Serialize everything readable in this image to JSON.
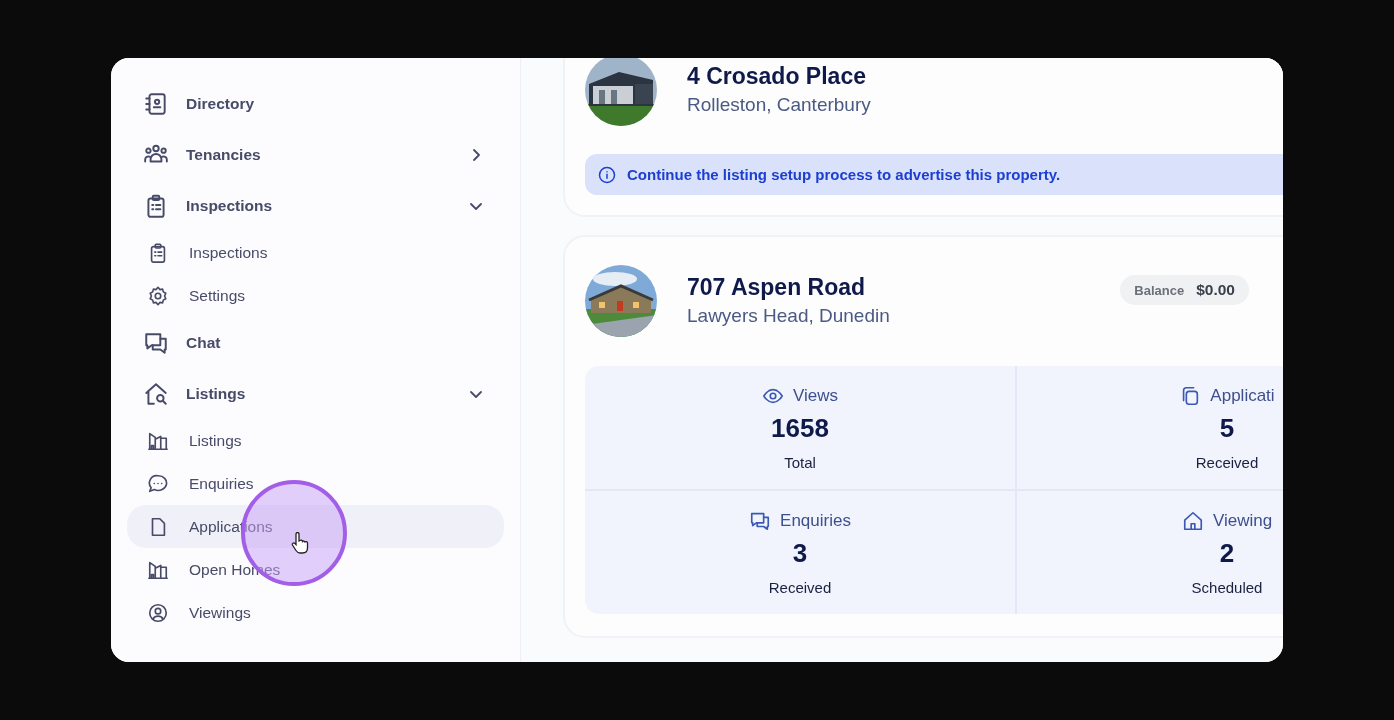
{
  "sidebar": {
    "items": [
      {
        "label": "Directory",
        "selected": false
      },
      {
        "label": "Tenancies",
        "selected": false,
        "expanded": false
      },
      {
        "label": "Inspections",
        "selected": false,
        "expanded": true,
        "children": [
          {
            "label": "Inspections",
            "selected": false
          },
          {
            "label": "Settings",
            "selected": false
          }
        ]
      },
      {
        "label": "Chat",
        "selected": false
      },
      {
        "label": "Listings",
        "selected": false,
        "expanded": true,
        "children": [
          {
            "label": "Listings",
            "selected": false
          },
          {
            "label": "Enquiries",
            "selected": false
          },
          {
            "label": "Applications",
            "selected": true
          },
          {
            "label": "Open Homes",
            "selected": false
          },
          {
            "label": "Viewings",
            "selected": false
          }
        ]
      }
    ]
  },
  "listings": [
    {
      "title": "4 Crosado Place",
      "location": "Rolleston, Canterbury",
      "notice": "Continue the listing setup process to advertise this property."
    },
    {
      "title": "707 Aspen Road",
      "location": "Lawyers Head, Dunedin",
      "balance_label": "Balance",
      "balance": "$0.00",
      "stats": [
        {
          "label": "Views",
          "value": "1658",
          "caption": "Total"
        },
        {
          "label": "Applicati",
          "value": "5",
          "caption": "Received"
        },
        {
          "label": "Enquiries",
          "value": "3",
          "caption": "Received"
        },
        {
          "label": "Viewing",
          "value": "2",
          "caption": "Scheduled"
        }
      ]
    }
  ]
}
